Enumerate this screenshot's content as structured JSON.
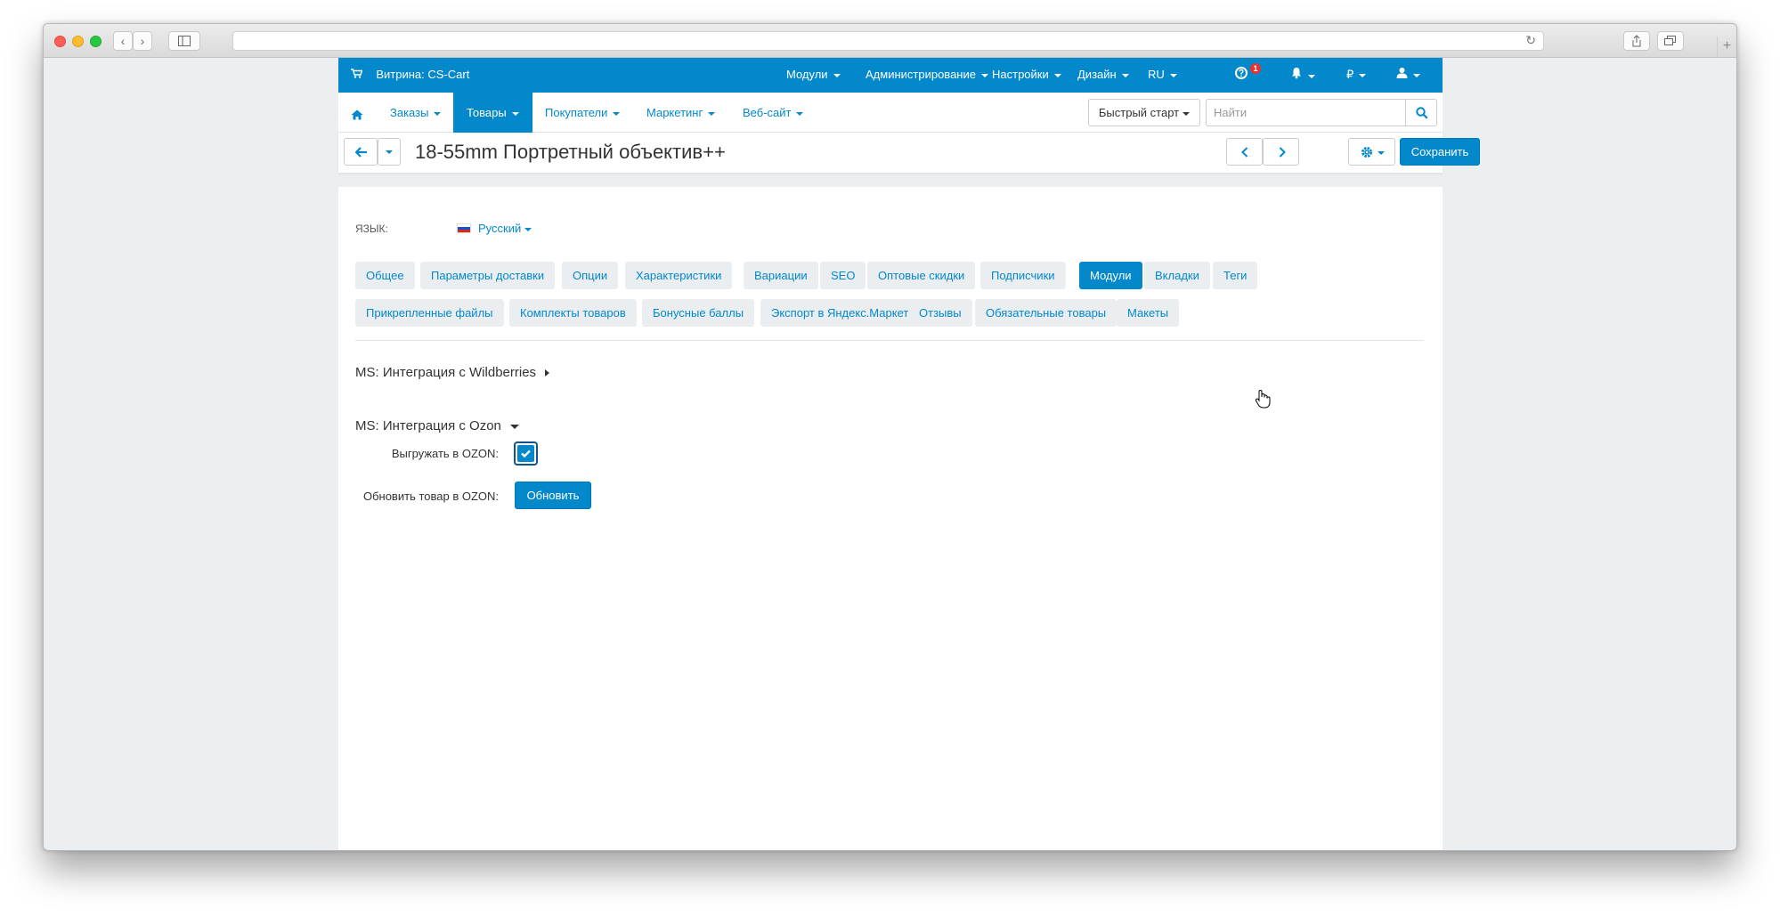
{
  "top": {
    "store_label": "Витрина: CS-Cart",
    "menu": [
      {
        "label": "Модули"
      },
      {
        "label": "Администрирование"
      },
      {
        "label": "Настройки"
      },
      {
        "label": "Дизайн"
      },
      {
        "label": "RU"
      }
    ],
    "notification_count": "1",
    "currency": "₽"
  },
  "nav": {
    "items": [
      {
        "label": "Заказы"
      },
      {
        "label": "Товары"
      },
      {
        "label": "Покупатели"
      },
      {
        "label": "Маркетинг"
      },
      {
        "label": "Веб-сайт"
      }
    ],
    "quick_start": "Быстрый старт",
    "search_placeholder": "Найти"
  },
  "page": {
    "title": "18-55mm Портретный объектив++",
    "save_label": "Сохранить"
  },
  "language": {
    "label": "ЯЗЫК:",
    "value": "Русский"
  },
  "tabs": {
    "row1": [
      "Общее",
      "Параметры доставки",
      "Опции",
      "Характеристики",
      "Вариации",
      "SEO",
      "Оптовые скидки",
      "Подписчики",
      "Модули",
      "Вкладки",
      "Теги"
    ],
    "row2": [
      "Прикрепленные файлы",
      "Комплекты товаров",
      "Бонусные баллы",
      "Экспорт в Яндекс.Маркет",
      "Отзывы",
      "Обязательные товары",
      "Макеты"
    ],
    "active": "Модули"
  },
  "modules": {
    "wildberries_title": "MS: Интеграция с Wildberries",
    "ozon_title": "MS: Интеграция с Ozon",
    "export_label": "Выгружать в OZON:",
    "export_checked": true,
    "update_label": "Обновить товар в OZON:",
    "update_button": "Обновить"
  },
  "colors": {
    "brand": "#0388cc",
    "page_bg": "#ebeff2"
  }
}
